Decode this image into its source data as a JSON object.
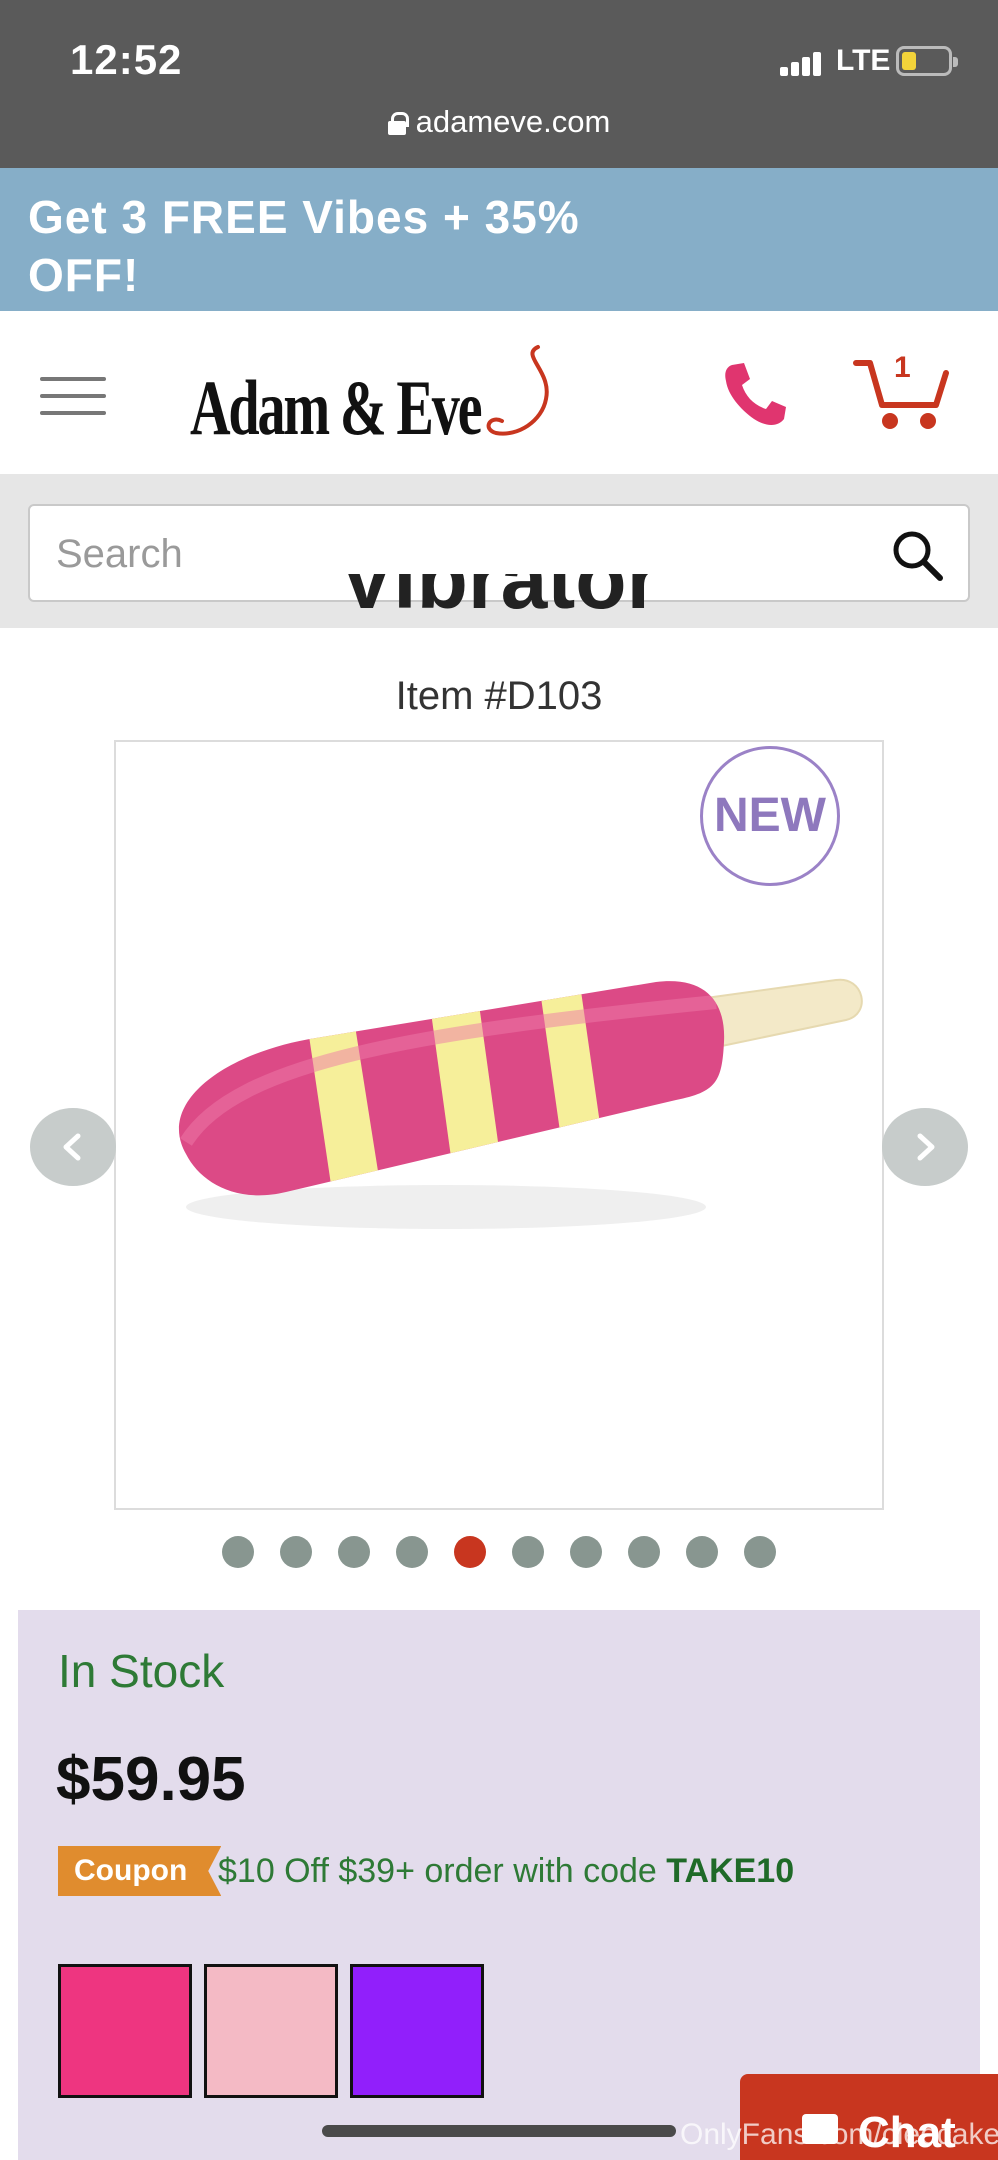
{
  "status_bar": {
    "time": "12:52",
    "network": "LTE"
  },
  "url_bar": {
    "domain": "adameve.com"
  },
  "promo": {
    "text": "Get 3 FREE Vibes + 35% OFF!"
  },
  "header": {
    "logo_text": "Adam & Eve",
    "cart_count": "1",
    "icons": [
      "menu-icon",
      "phone-icon",
      "cart-icon"
    ]
  },
  "search": {
    "placeholder": "Search"
  },
  "product": {
    "title_partial": "Vibrator",
    "item_number": "Item #D103",
    "badge": "NEW",
    "gallery_image_count": 10,
    "gallery_active_index": 4
  },
  "purchase": {
    "stock_status": "In Stock",
    "price": "$59.95",
    "coupon_badge": "Coupon",
    "coupon_text": "$10 Off $39+ order with code ",
    "coupon_code": "TAKE10",
    "swatches": [
      "#ee3580",
      "#f4bac5",
      "#911ffb"
    ]
  },
  "chat": {
    "label": "Chat"
  },
  "watermark": {
    "text": "OnlyFans.com/cleocake"
  },
  "colors": {
    "status_bar": "#5a5a5a",
    "promo_bg": "#86aec8",
    "brand_red": "#c8361f",
    "stock_green": "#2e7a36",
    "panel_bg": "#e3dcec",
    "coupon_orange": "#e08c2e"
  }
}
